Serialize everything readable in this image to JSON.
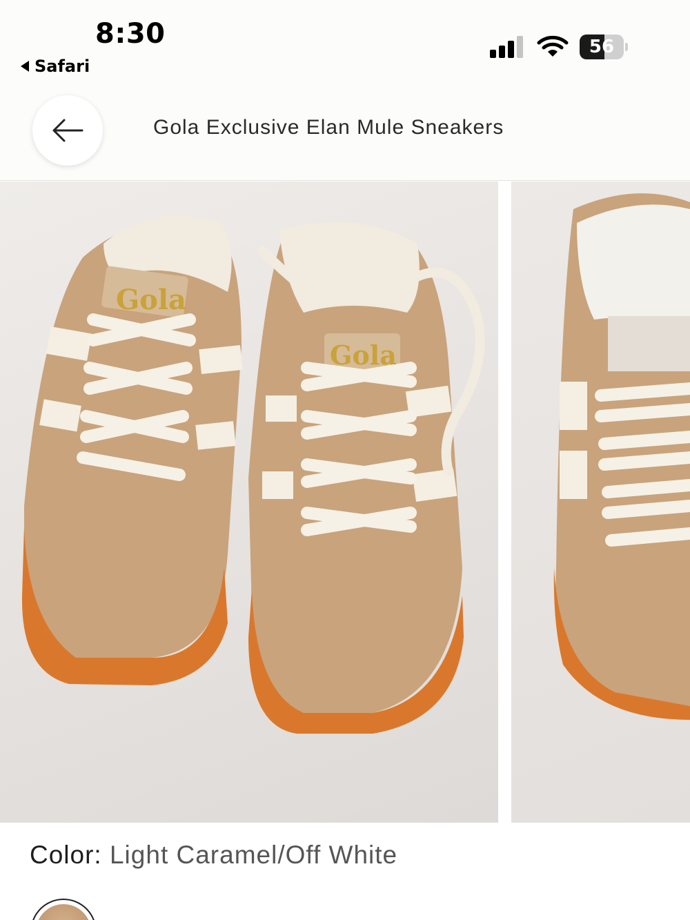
{
  "status_bar": {
    "time": "8:30",
    "back_app": "Safari",
    "battery_level": "56",
    "battery_fraction": 0.56
  },
  "header": {
    "title": "Gola Exclusive Elan Mule Sneakers",
    "back_icon": "arrow-left-icon"
  },
  "gallery": {
    "images": [
      {
        "brand_text": "Gola"
      },
      {
        "brand_text": "Gola"
      }
    ]
  },
  "color": {
    "label": "Color:",
    "value": "Light Caramel/Off White"
  },
  "colors": {
    "suede": "#c9a37c",
    "sole": "#d9782c",
    "stripe": "#f4efe2",
    "logo_gold": "#c9a23a"
  }
}
